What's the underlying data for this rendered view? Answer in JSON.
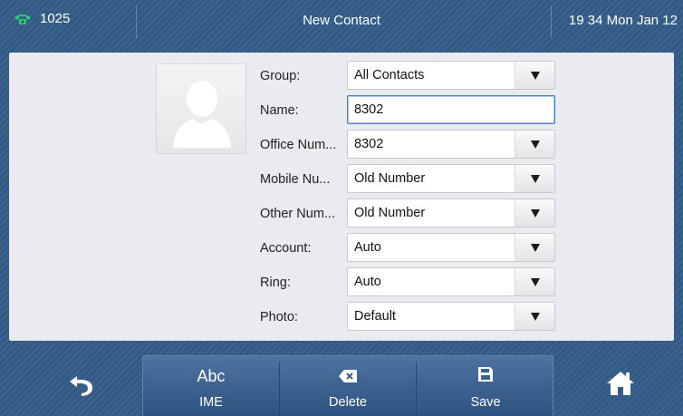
{
  "status_bar": {
    "line_number": "1025",
    "title": "New Contact",
    "datetime": "19 34 Mon Jan 12",
    "phone_icon_color": "#2ecc71"
  },
  "form": {
    "fields": [
      {
        "label": "Group:",
        "value": "All Contacts",
        "dropdown": true
      },
      {
        "label": "Name:",
        "value": "8302",
        "dropdown": false,
        "active": true
      },
      {
        "label": "Office Num...",
        "value": "8302",
        "dropdown": true
      },
      {
        "label": "Mobile Nu...",
        "value": "Old Number",
        "dropdown": true
      },
      {
        "label": "Other Num...",
        "value": "Old Number",
        "dropdown": true
      },
      {
        "label": "Account:",
        "value": "Auto",
        "dropdown": true
      },
      {
        "label": "Ring:",
        "value": "Auto",
        "dropdown": true
      },
      {
        "label": "Photo:",
        "value": "Default",
        "dropdown": true
      }
    ]
  },
  "softkeys": {
    "back_icon": "back-arrow-icon",
    "ime_top": "Abc",
    "ime_label": "IME",
    "delete_label": "Delete",
    "save_label": "Save",
    "home_icon": "home-icon"
  }
}
